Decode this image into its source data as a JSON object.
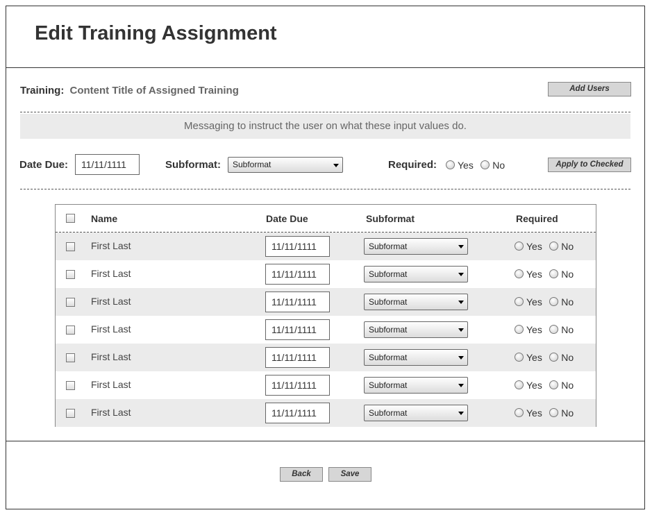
{
  "page": {
    "title": "Edit Training Assignment"
  },
  "training": {
    "label": "Training:",
    "value": "Content Title of Assigned Training",
    "add_users_label": "Add Users"
  },
  "message": "Messaging to instruct the user on what these input values do.",
  "bulk": {
    "date_due_label": "Date Due:",
    "date_due_value": "11/11/1111",
    "subformat_label": "Subformat:",
    "subformat_value": "Subformat",
    "required_label": "Required:",
    "yes_label": "Yes",
    "no_label": "No",
    "apply_label": "Apply to Checked"
  },
  "table": {
    "headers": {
      "name": "Name",
      "date_due": "Date Due",
      "subformat": "Subformat",
      "required": "Required"
    },
    "rows": [
      {
        "name": "First Last",
        "date_due": "11/11/1111",
        "subformat": "Subformat",
        "yes": "Yes",
        "no": "No"
      },
      {
        "name": "First Last",
        "date_due": "11/11/1111",
        "subformat": "Subformat",
        "yes": "Yes",
        "no": "No"
      },
      {
        "name": "First Last",
        "date_due": "11/11/1111",
        "subformat": "Subformat",
        "yes": "Yes",
        "no": "No"
      },
      {
        "name": "First Last",
        "date_due": "11/11/1111",
        "subformat": "Subformat",
        "yes": "Yes",
        "no": "No"
      },
      {
        "name": "First Last",
        "date_due": "11/11/1111",
        "subformat": "Subformat",
        "yes": "Yes",
        "no": "No"
      },
      {
        "name": "First Last",
        "date_due": "11/11/1111",
        "subformat": "Subformat",
        "yes": "Yes",
        "no": "No"
      },
      {
        "name": "First Last",
        "date_due": "11/11/1111",
        "subformat": "Subformat",
        "yes": "Yes",
        "no": "No"
      }
    ]
  },
  "footer": {
    "back_label": "Back",
    "save_label": "Save"
  }
}
